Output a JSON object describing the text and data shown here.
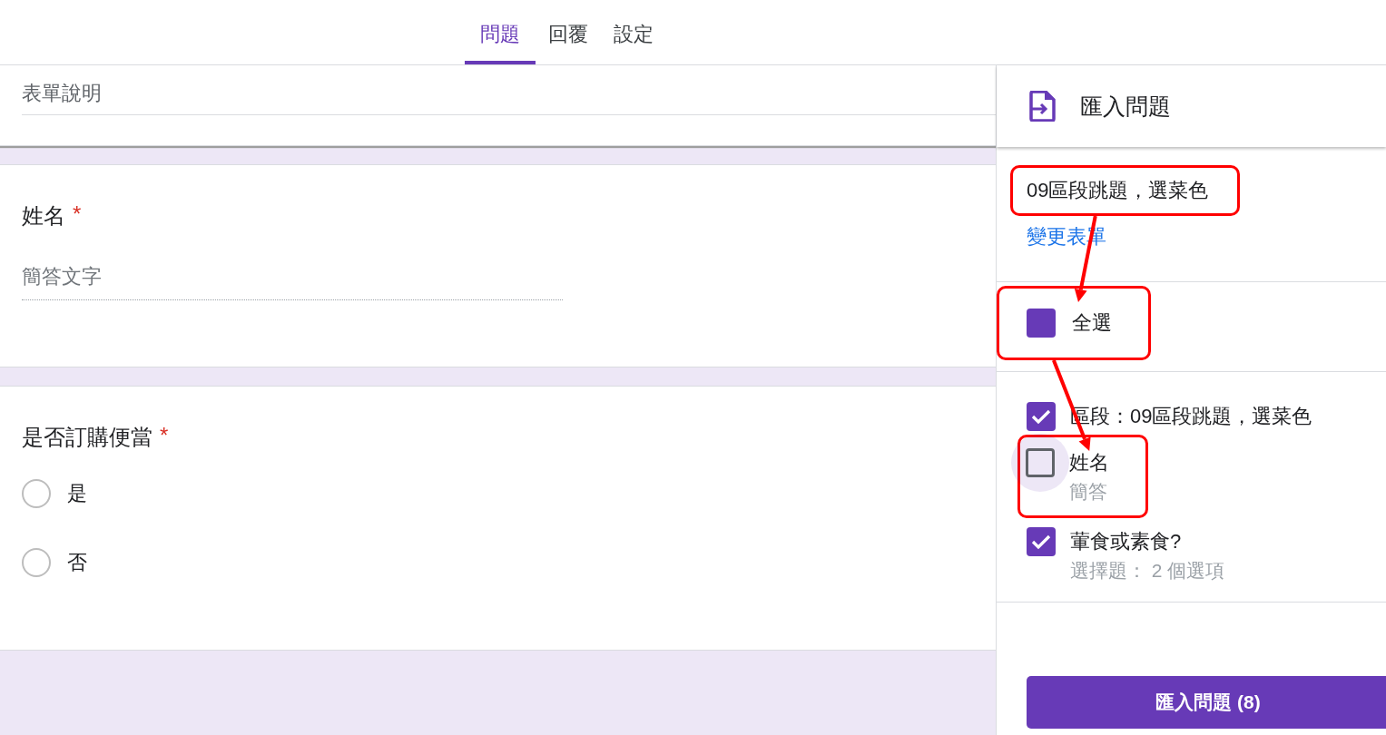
{
  "tabs": [
    {
      "label": "問題",
      "selected": true
    },
    {
      "label": "回覆",
      "selected": false
    },
    {
      "label": "設定",
      "selected": false
    }
  ],
  "form": {
    "description_placeholder": "表單說明",
    "questions": [
      {
        "kind": "short",
        "title": "姓名",
        "required_mark": "*",
        "placeholder": "簡答文字"
      },
      {
        "kind": "radio",
        "title": "是否訂購便當",
        "required_mark": "*",
        "options": [
          {
            "label": "是",
            "selected": false
          },
          {
            "label": "否",
            "selected": false
          }
        ]
      }
    ]
  },
  "panel": {
    "title": "匯入問題",
    "form_name": {
      "text": "09區段跳題，選菜色",
      "highlighted": true
    },
    "change_link": "變更表單",
    "select_all": {
      "label": "全選",
      "checked": false,
      "indeterminate": true,
      "highlighted": true
    },
    "items": [
      {
        "title": "區段：09區段跳題，選菜色",
        "checked": true,
        "focused": false,
        "highlighted": false
      },
      {
        "title": "姓名",
        "subtitle": "簡答",
        "checked": false,
        "focused": true,
        "highlighted": true
      },
      {
        "title": "葷食或素食?",
        "subtitle": "選擇題： 2 個選項",
        "checked": true,
        "focused": false,
        "highlighted": false
      }
    ],
    "arrows_between_highlights": true,
    "import_button": "匯入問題 (8)"
  }
}
